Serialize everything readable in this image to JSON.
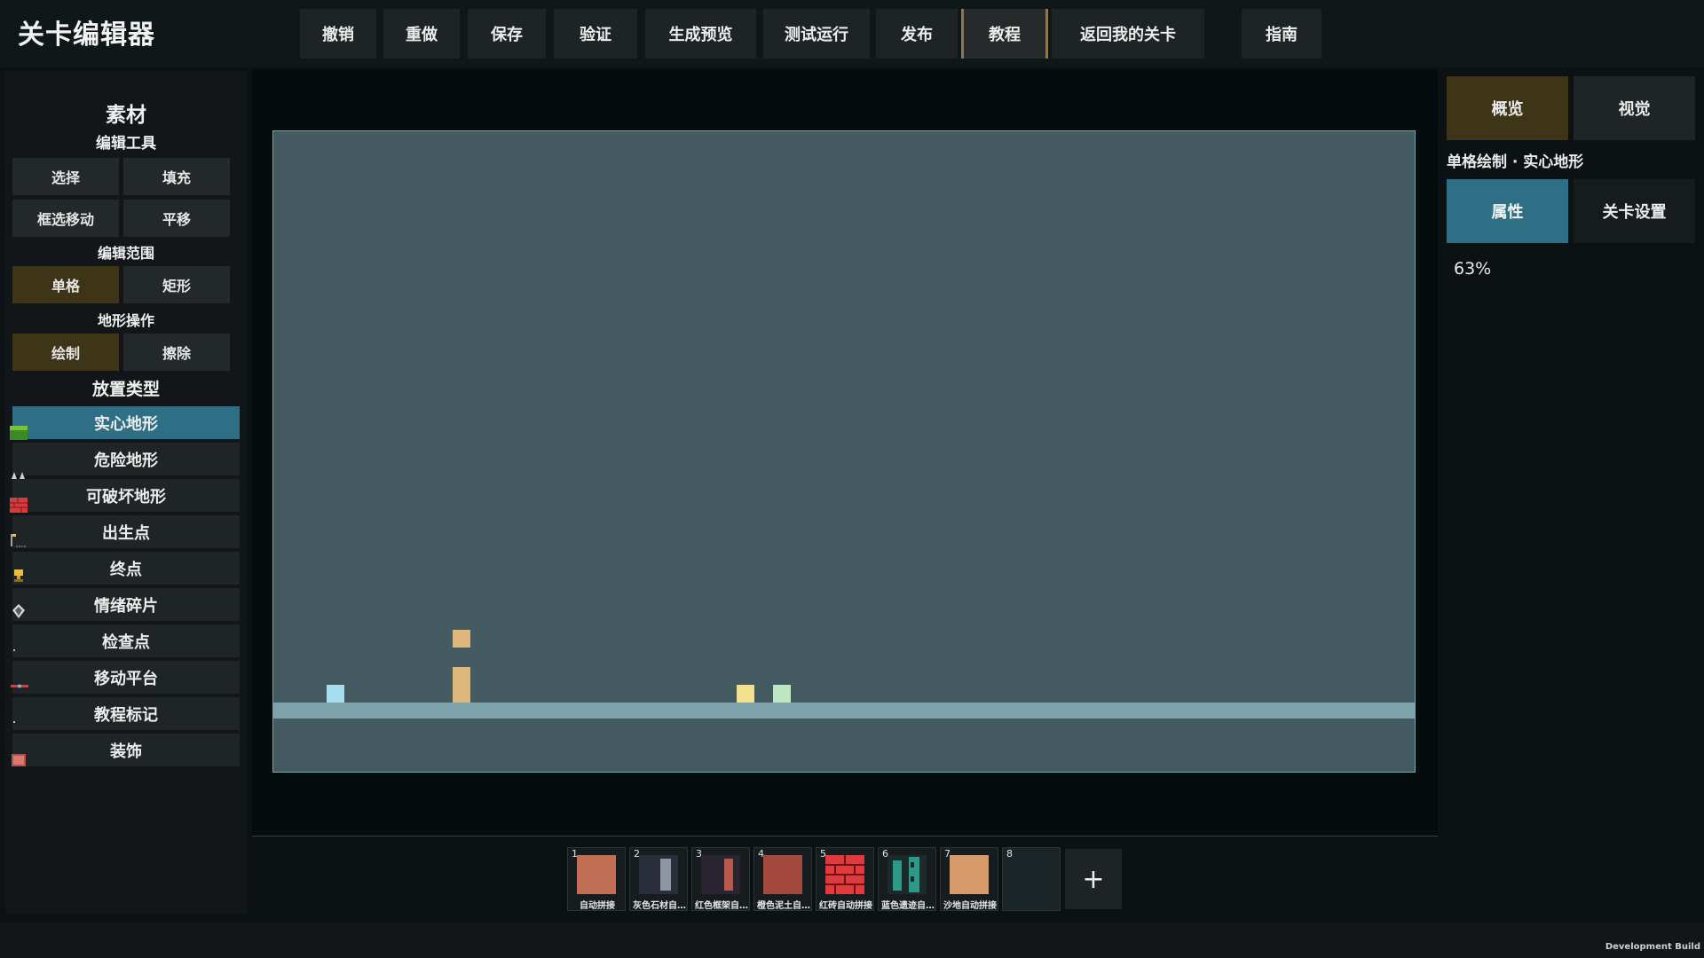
{
  "app_title": "关卡编辑器",
  "toolbar": {
    "undo": "撤销",
    "redo": "重做",
    "save": "保存",
    "validate": "验证",
    "generate_preview": "生成预览",
    "test_run": "测试运行",
    "publish": "发布",
    "tutorial": "教程",
    "back_to_my_levels": "返回我的关卡",
    "guide": "指南"
  },
  "left_panel": {
    "title": "素材",
    "edit_tools": {
      "heading": "编辑工具",
      "select": "选择",
      "fill": "填充",
      "box_move": "框选移动",
      "pan": "平移"
    },
    "edit_range": {
      "heading": "编辑范围",
      "single": "单格",
      "rect": "矩形"
    },
    "terrain_op": {
      "heading": "地形操作",
      "draw": "绘制",
      "erase": "擦除"
    },
    "place_type": {
      "heading": "放置类型",
      "items": [
        {
          "label": "实心地形",
          "icon": "grass-block-icon"
        },
        {
          "label": "危险地形",
          "icon": "spike-icon"
        },
        {
          "label": "可破坏地形",
          "icon": "brick-icon"
        },
        {
          "label": "出生点",
          "icon": "flag-icon"
        },
        {
          "label": "终点",
          "icon": "trophy-icon"
        },
        {
          "label": "情绪碎片",
          "icon": "shard-icon"
        },
        {
          "label": "检查点",
          "icon": "checkpoint-icon"
        },
        {
          "label": "移动平台",
          "icon": "platform-icon"
        },
        {
          "label": "教程标记",
          "icon": "marker-icon"
        },
        {
          "label": "装饰",
          "icon": "decoration-icon"
        }
      ]
    }
  },
  "right_panel": {
    "overview": "概览",
    "visual": "视觉",
    "mode_line": "单格绘制 · 实心地形",
    "properties": "属性",
    "level_settings": "关卡设置",
    "zoom": "63%"
  },
  "hotbar": {
    "slots": [
      {
        "num": "1",
        "label": "自动拼接",
        "color": "#c26e55"
      },
      {
        "num": "2",
        "label": "灰色石材自…",
        "color": "#6e7480"
      },
      {
        "num": "3",
        "label": "红色框架自…",
        "color": "#9a4a3e"
      },
      {
        "num": "4",
        "label": "橙色泥土自…",
        "color": "#a4493f"
      },
      {
        "num": "5",
        "label": "红砖自动拼接",
        "color": "#e03a3e"
      },
      {
        "num": "6",
        "label": "蓝色遗迹自…",
        "color": "#2c9a86"
      },
      {
        "num": "7",
        "label": "沙地自动拼接",
        "color": "#d69a6a"
      },
      {
        "num": "8",
        "label": "",
        "color": "#1f2a2e"
      }
    ],
    "add": "+"
  },
  "footer": {
    "dev_build": "Development Build"
  },
  "colors": {
    "selected_gold": "#3e3418",
    "selected_teal": "#2f6f86",
    "canvas_bg": "#435a60",
    "ground": "#7fa3aa"
  }
}
